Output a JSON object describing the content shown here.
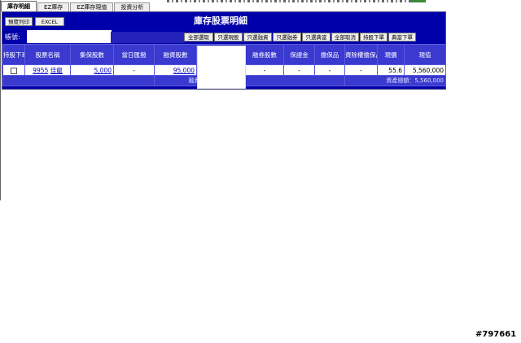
{
  "tabs": [
    {
      "label": "庫存明細",
      "active": true
    },
    {
      "label": "EZ庫存",
      "active": false
    },
    {
      "label": "EZ庫存現值",
      "active": false
    },
    {
      "label": "投資分析",
      "active": false
    }
  ],
  "toolbar": {
    "preview_print": "預覽列印",
    "excel": "EXCEL",
    "title": "庫存股票明細"
  },
  "account": {
    "label": "帳號:",
    "value": ""
  },
  "select_buttons": [
    "全部選取",
    "只選現股",
    "只選融資",
    "只選融券",
    "只選典當",
    "全部取消",
    "持股下單",
    "典當下單"
  ],
  "columns": [
    "持股下單",
    "股票名稱",
    "集保股數",
    "當日匯撥",
    "融資股數",
    "",
    "融券股數",
    "保證金",
    "擔保品",
    "資除權擔保品",
    "現價",
    "現值"
  ],
  "rows": [
    {
      "code": "9955",
      "name": "佳龍",
      "depository_shares": "5,000",
      "same_day": "-",
      "margin_shares": "95,000",
      "short_shares": "-",
      "deposit": "-",
      "collateral": "-",
      "ex_rights_collateral": "-",
      "price": "55.6",
      "value": "5,560,000"
    }
  ],
  "totals": {
    "margin_total_label": "融資總額",
    "asset_total": "資產總額：5,560,000"
  },
  "watermark": "#797661",
  "colors": {
    "panel": "#0000aa",
    "header": "#3a3ad0",
    "link": "#0000cc"
  }
}
